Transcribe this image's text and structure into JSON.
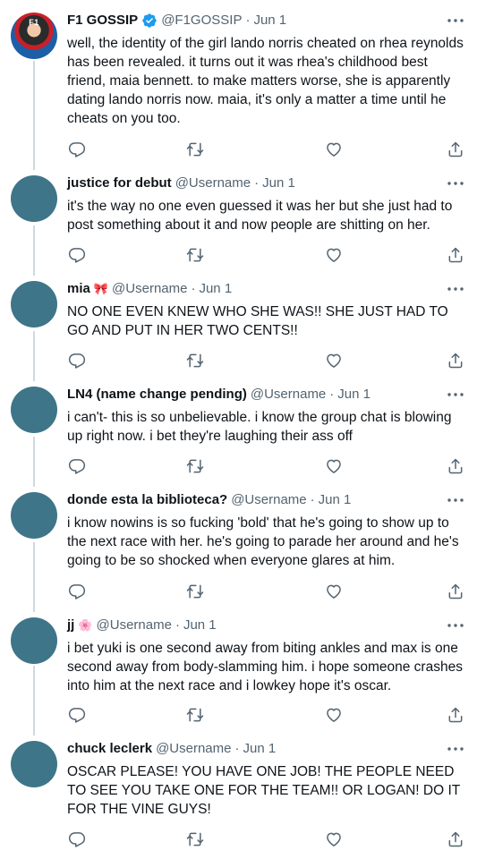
{
  "colors": {
    "text": "#0f1419",
    "secondary": "#536471",
    "verified": "#1d9bf0",
    "avatar_placeholder": "#3e7589",
    "thread_line": "#cfd9de"
  },
  "icons": {
    "reply": "reply-icon",
    "retweet": "retweet-icon",
    "like": "heart-icon",
    "share": "share-icon",
    "more": "more-icon",
    "verified": "verified-badge-icon"
  },
  "tweets": [
    {
      "display_name": "F1 GOSSIP",
      "handle": "@F1GOSSIP",
      "dot": "·",
      "date": "Jun 1",
      "verified": true,
      "avatar_text": "F1",
      "text": "well, the identity of the girl lando norris cheated on rhea reynolds has been revealed. it turns out it was rhea's childhood best friend, maia bennett. to make matters worse, she is apparently dating lando norris now. maia, it's only a matter a time until he cheats on you too."
    },
    {
      "display_name": "justice for debut",
      "handle": "@Username",
      "dot": "·",
      "date": "Jun 1",
      "text": "it's the way no one even guessed it was her but she just had to post something about it and now people are shitting on her."
    },
    {
      "display_name": "mia",
      "emoji": "🎀",
      "handle": "@Username",
      "dot": "·",
      "date": "Jun 1",
      "text": "NO ONE EVEN KNEW WHO SHE WAS!! SHE JUST HAD TO GO AND PUT IN HER TWO CENTS!!"
    },
    {
      "display_name": "LN4 (name change pending)",
      "handle": "@Username",
      "dot": "·",
      "date": "Jun 1",
      "text": "i can't- this is so unbelievable. i know the group chat is blowing up right now. i bet they're laughing their ass off"
    },
    {
      "display_name": "donde esta la biblioteca?",
      "handle": "@Username",
      "dot": "·",
      "date": "Jun 1",
      "text": "i know nowins is so fucking 'bold' that he's going to show up to the next race with her. he's going to parade her around and he's going to be so shocked when everyone glares at him."
    },
    {
      "display_name": "jj",
      "emoji": "🌸",
      "handle": "@Username",
      "dot": "·",
      "date": "Jun 1",
      "text": "i bet yuki is one second away from biting ankles and max is one second away from body-slamming him. i hope someone crashes into him at the next race and i lowkey hope it's oscar."
    },
    {
      "display_name": "chuck leclerk",
      "handle": "@Username",
      "dot": "·",
      "date": "Jun 1",
      "text": "OSCAR PLEASE! YOU HAVE ONE JOB! THE PEOPLE NEED TO SEE YOU TAKE ONE FOR THE TEAM!! OR LOGAN! DO IT FOR THE VINE GUYS!"
    }
  ]
}
